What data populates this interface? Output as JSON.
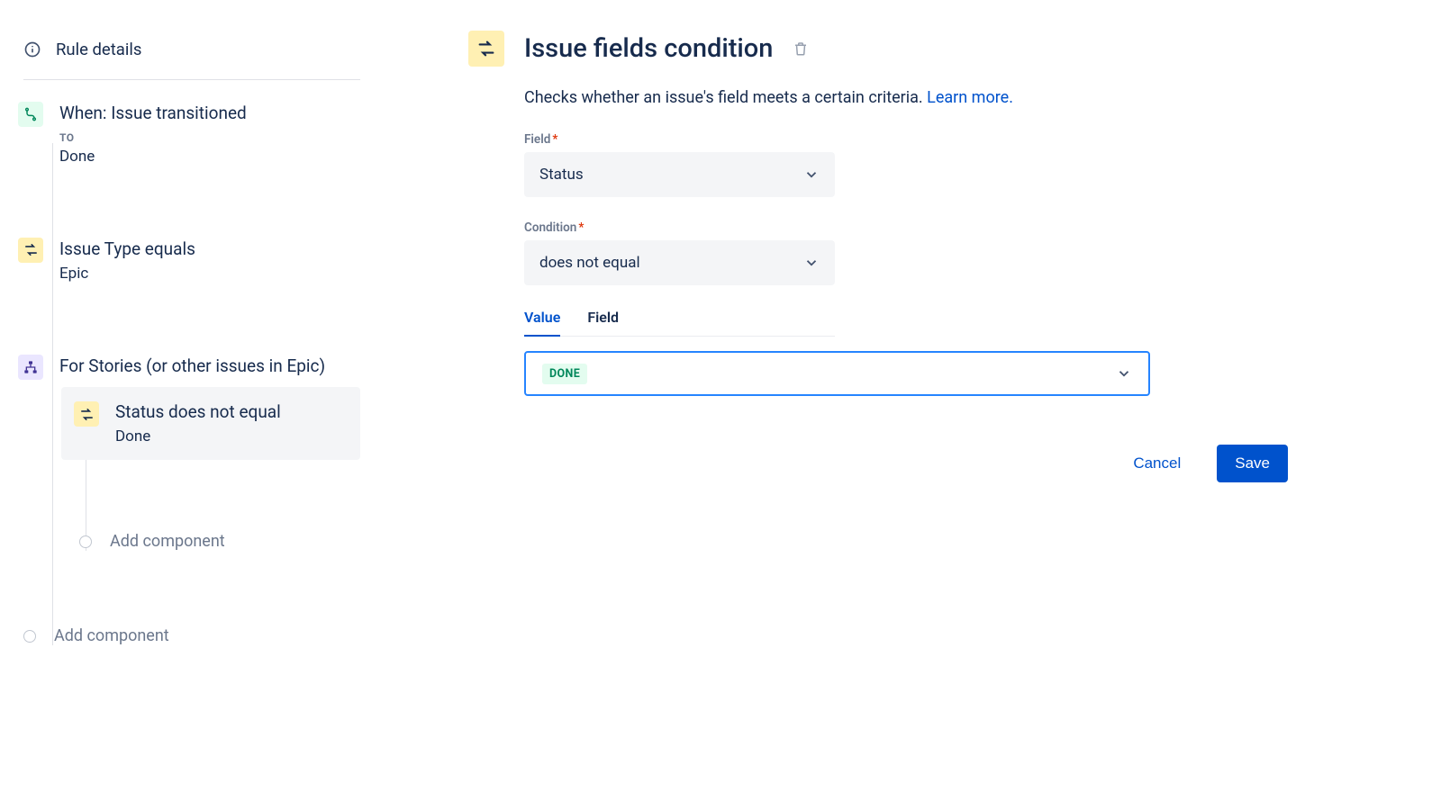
{
  "sidebar": {
    "header": "Rule details",
    "steps": [
      {
        "title": "When: Issue transitioned",
        "tag": "TO",
        "sub": "Done"
      },
      {
        "title": "Issue Type equals",
        "sub": "Epic"
      },
      {
        "title": "For Stories (or other issues in Epic)"
      }
    ],
    "nested": {
      "title": "Status does not equal",
      "sub": "Done"
    },
    "add_label": "Add component"
  },
  "main": {
    "title": "Issue fields condition",
    "description": "Checks whether an issue's field meets a certain criteria. ",
    "learn_more": "Learn more.",
    "field_label": "Field",
    "field_value": "Status",
    "condition_label": "Condition",
    "condition_value": "does not equal",
    "tabs": {
      "value": "Value",
      "field": "Field"
    },
    "value_chip": "DONE",
    "cancel": "Cancel",
    "save": "Save"
  }
}
